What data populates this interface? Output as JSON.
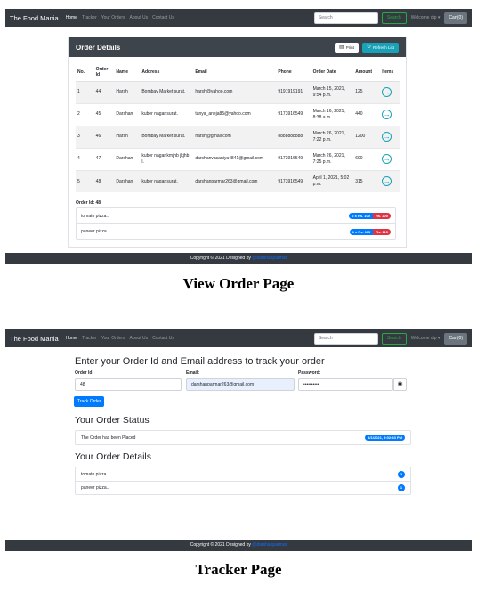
{
  "navbar": {
    "brand": "The Food Mania",
    "links": [
      "Home",
      "Tracker",
      "Your Orders",
      "About Us",
      "Contact Us"
    ],
    "search_placeholder": "Search",
    "search_button": "Search",
    "welcome": "Welcome dip ▾",
    "cart": "Cart(0)"
  },
  "view_order": {
    "card_title": "Order Details",
    "print_button": "Print",
    "refresh_button": "Refresh List",
    "columns": [
      "No.",
      "Order Id",
      "Name",
      "Address",
      "Email",
      "Phone",
      "Order Date",
      "Amount",
      "Items"
    ],
    "rows": [
      {
        "no": "1",
        "order_id": "44",
        "name": "Harsh",
        "address": "Bombay Market surat.",
        "email": "harsh@yahoo.com",
        "phone": "9191919191",
        "date": "March 15, 2021, 9:54 p.m.",
        "amount": "125"
      },
      {
        "no": "2",
        "order_id": "45",
        "name": "Darshan",
        "address": "kuber nagar surat.",
        "email": "tanya_aneja85@yahoo.com",
        "phone": "9173916549",
        "date": "March 16, 2021, 8:38 a.m.",
        "amount": "440"
      },
      {
        "no": "3",
        "order_id": "46",
        "name": "Harsh",
        "address": "Bombay Market surat.",
        "email": "harsh@gmail.com",
        "phone": "8888888888",
        "date": "March 26, 2021, 7:22 p.m.",
        "amount": "1200"
      },
      {
        "no": "4",
        "order_id": "47",
        "name": "Darshan",
        "address": "kuber nagar kmjhb jkjhb l.",
        "email": "darshanvasaniya4841@gmail.com",
        "phone": "9173916549",
        "date": "March 26, 2021, 7:25 p.m.",
        "amount": "690"
      },
      {
        "no": "5",
        "order_id": "48",
        "name": "Darshan",
        "address": "kuber nagar surat.",
        "email": "darshanparmar263@gmail.com",
        "phone": "9173916549",
        "date": "April 1, 2021, 5:02 p.m.",
        "amount": "315"
      }
    ],
    "selected_order_label": "Order Id: 48",
    "items": [
      {
        "name": "tomato pizza..",
        "qty": "2 x Rs. 100",
        "total": "Rs. 200"
      },
      {
        "name": "paneer pizza..",
        "qty": "1 x Rs. 115",
        "total": "Rs. 115"
      }
    ],
    "footer": {
      "text": "Copyright © 2021 Designed by",
      "link": "@darshanparmar"
    },
    "caption": "View Order Page"
  },
  "tracker": {
    "heading": "Enter your Order Id and Email address to track your order",
    "order_id_label": "Order Id:",
    "order_id_value": "48",
    "email_label": "Email:",
    "email_value": "darshanparmar263@gmail.com",
    "password_label": "Password:",
    "password_value": "••••••••••",
    "track_button": "Track Order",
    "status_heading": "Your Order Status",
    "status_text": "The Order has been Placed",
    "status_time": "4/1/2021, 5:02:43 PM",
    "details_heading": "Your Order Details",
    "detail_items": [
      {
        "name": "tomato pizza..",
        "qty": "2"
      },
      {
        "name": "paneer pizza..",
        "qty": "1"
      }
    ],
    "footer": {
      "text": "Copyright © 2021 Designed by",
      "link": "@darshanparmar"
    },
    "caption": "Tracker Page"
  },
  "icons": {
    "print": "printer-icon",
    "refresh": "refresh-icon",
    "view": "arrow-circle-right-icon",
    "eye": "eye-icon"
  },
  "colors": {
    "navbar": "#343a40",
    "success": "#28a745",
    "info": "#17a2b8",
    "primary": "#007bff",
    "danger": "#dc3545"
  }
}
